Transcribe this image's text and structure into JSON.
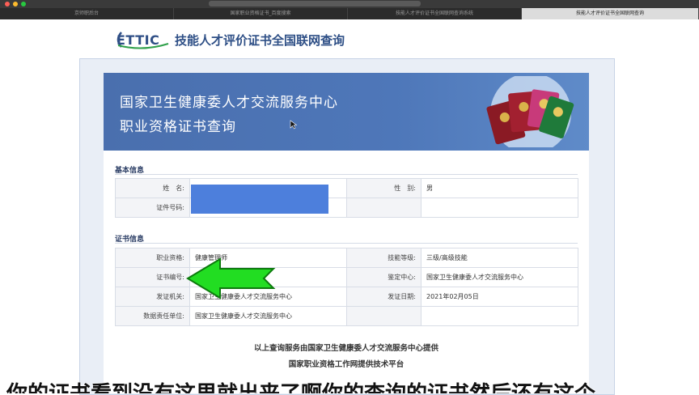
{
  "browser": {
    "url": "",
    "tabs": [
      {
        "label": "京师职后台",
        "active": false
      },
      {
        "label": "国家职业资格证书_百度搜索",
        "active": false
      },
      {
        "label": "技能人才评价证书全国联网查询系统",
        "active": false
      },
      {
        "label": "技能人才评价证书全国联网查询",
        "active": true
      }
    ]
  },
  "site": {
    "logo_text": "ETTIC",
    "title": "技能人才评价证书全国联网查询"
  },
  "banner": {
    "line1": "国家卫生健康委人才交流服务中心",
    "line2": "职业资格证书查询"
  },
  "basic_info": {
    "section_title": "基本信息",
    "name_label": "姓　名:",
    "name_value": "",
    "gender_label": "性　别:",
    "gender_value": "男",
    "id_label": "证件号码:",
    "id_value": ""
  },
  "cert_info": {
    "section_title": "证书信息",
    "qualification_label": "职业资格:",
    "qualification_value": "健康管理师",
    "level_label": "技能等级:",
    "level_value": "三级/高级技能",
    "cert_no_label": "证书编号:",
    "cert_no_value": "",
    "appraisal_center_label": "鉴定中心:",
    "appraisal_center_value": "国家卫生健康委人才交流服务中心",
    "issuer_label": "发证机关:",
    "issuer_value": "国家卫生健康委人才交流服务中心",
    "issue_date_label": "发证日期:",
    "issue_date_value": "2021年02月05日",
    "data_unit_label": "数据责任单位:",
    "data_unit_value": "国家卫生健康委人才交流服务中心"
  },
  "footer": {
    "line1": "以上查询服务由国家卫生健康委人才交流服务中心提供",
    "line2": "国家职业资格工作网提供技术平台"
  },
  "subtitle": "你的证书看到没有这里就出来了啊你的查询的证书然后还有这个",
  "colors": {
    "banner_blue": "#4a6fae",
    "mask_blue": "#4d7fdc",
    "arrow_green": "#22dd22"
  }
}
